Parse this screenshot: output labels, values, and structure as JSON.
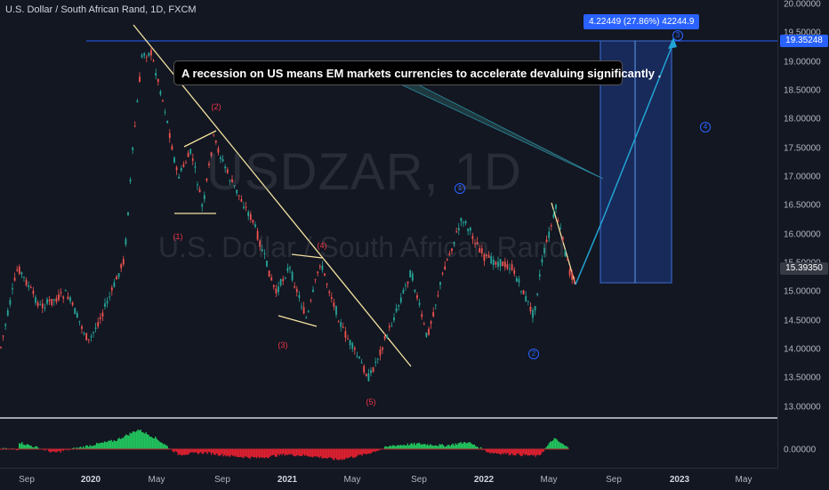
{
  "title": "U.S. Dollar / South African Rand, 1D, FXCM",
  "watermark": {
    "symbol": "USDZAR, 1D",
    "name": "U.S. Dollar / South African Rand"
  },
  "annotation": "A recession on US means EM markets currencies to accelerate devaluing significantly .",
  "measure_label": "4.22449 (27.86%) 42244.9",
  "price_axis": [
    "20.00000",
    "19.50000",
    "19.00000",
    "18.50000",
    "18.00000",
    "17.50000",
    "17.00000",
    "16.50000",
    "16.00000",
    "15.50000",
    "15.00000",
    "14.50000",
    "14.00000",
    "13.50000",
    "13.00000"
  ],
  "price_tags": {
    "target": "19.35248",
    "current": "15.39350"
  },
  "oscillator_axis": "0.00000",
  "time_axis": [
    {
      "label": "Sep",
      "bold": false
    },
    {
      "label": "2020",
      "bold": true
    },
    {
      "label": "May",
      "bold": false
    },
    {
      "label": "Sep",
      "bold": false
    },
    {
      "label": "2021",
      "bold": true
    },
    {
      "label": "May",
      "bold": false
    },
    {
      "label": "Sep",
      "bold": false
    },
    {
      "label": "2022",
      "bold": true
    },
    {
      "label": "May",
      "bold": false
    },
    {
      "label": "Sep",
      "bold": false
    },
    {
      "label": "2023",
      "bold": true
    },
    {
      "label": "May",
      "bold": false
    }
  ],
  "waves_red": [
    "(1)",
    "(2)",
    "(3)",
    "(4)",
    "(5)"
  ],
  "waves_blue": [
    "1",
    "2",
    "3",
    "4"
  ],
  "colors": {
    "background": "#131722",
    "up": "#26a69a",
    "down": "#ef5350",
    "trendline": "#f0e68c",
    "accent": "#2962ff"
  }
}
